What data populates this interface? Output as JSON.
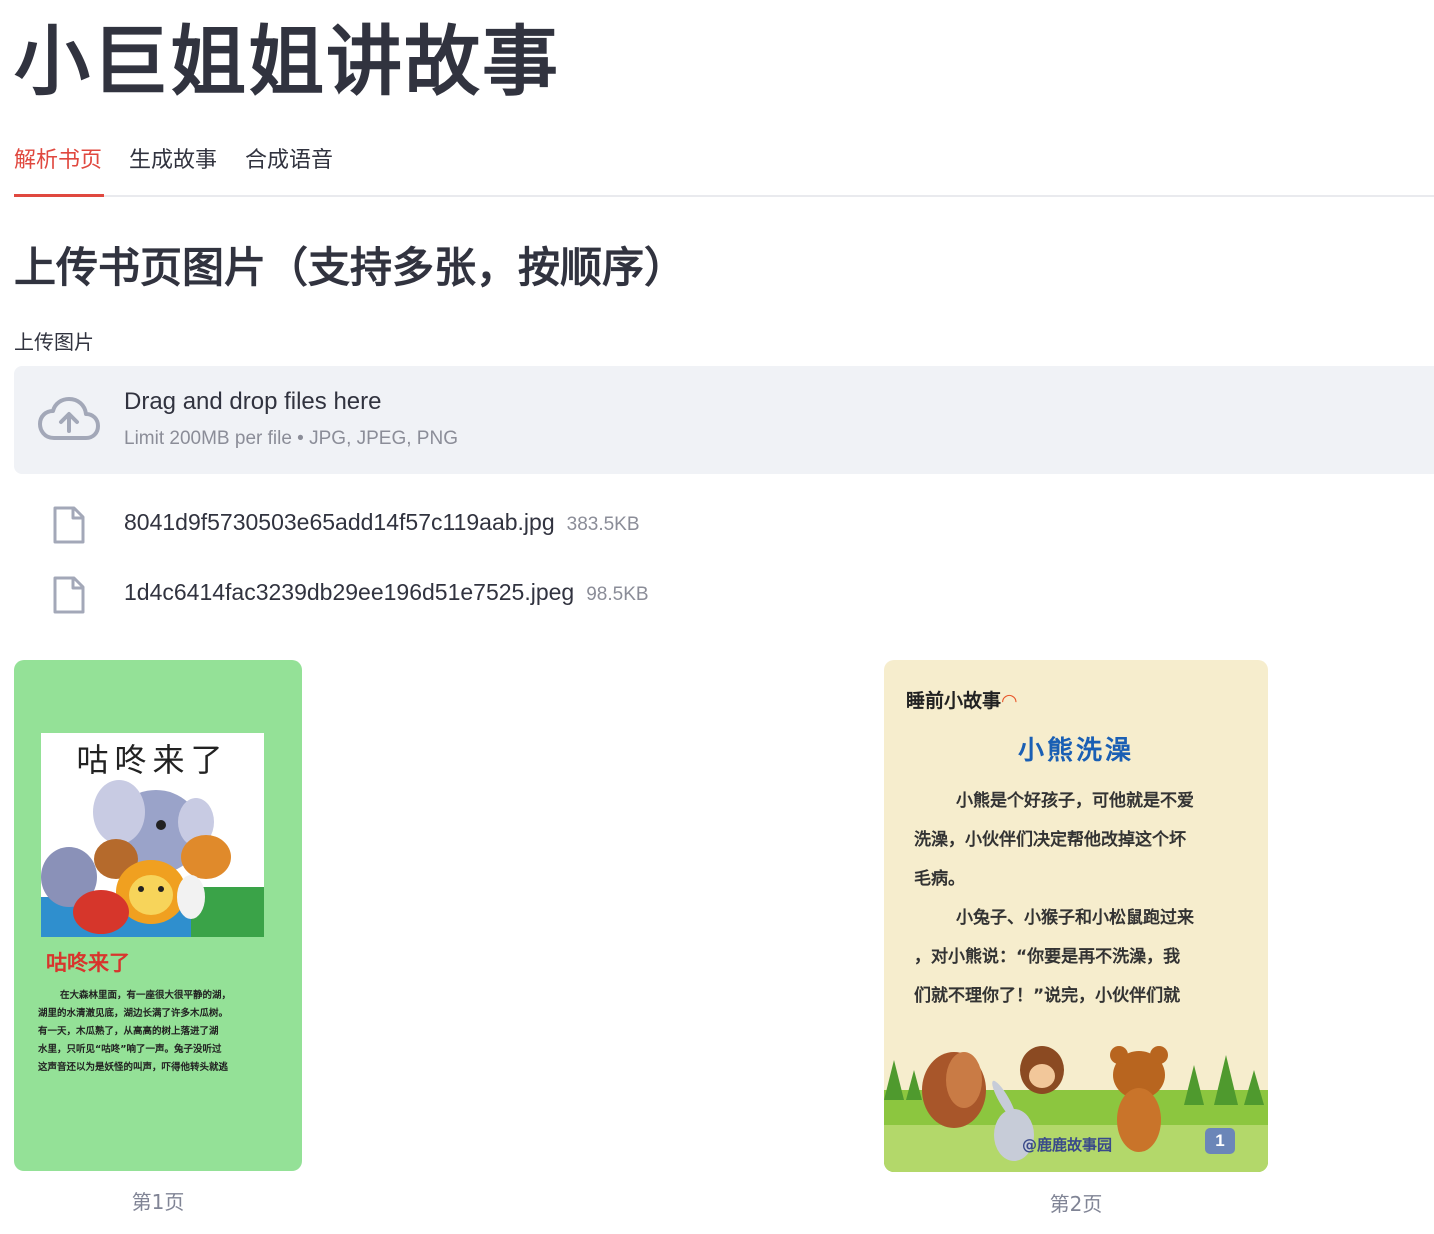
{
  "app": {
    "title": "小巨姐姐讲故事"
  },
  "tabs": [
    {
      "label": "解析书页",
      "active": true
    },
    {
      "label": "生成故事",
      "active": false
    },
    {
      "label": "合成语音",
      "active": false
    }
  ],
  "section": {
    "title": "上传书页图片（支持多张，按顺序）"
  },
  "uploader": {
    "label": "上传图片",
    "dropzone_main": "Drag and drop files here",
    "dropzone_sub": "Limit 200MB per file • JPG, JPEG, PNG",
    "files": [
      {
        "name": "8041d9f5730503e65add14f57c119aab.jpg",
        "size": "383.5KB"
      },
      {
        "name": "1d4c6414fac3239db29ee196d51e7525.jpeg",
        "size": "98.5KB"
      }
    ]
  },
  "pages": [
    {
      "caption": "第1页",
      "book_title": "咕咚来了",
      "heading": "咕咚来了",
      "body_lines": [
        "在大森林里面，有一座很大很平静的湖，",
        "湖里的水清澈见底，湖边长满了许多木瓜树。",
        "有一天，木瓜熟了，从高高的树上落进了湖",
        "水里，只听见“咕咚”响了一声。兔子没听过",
        "这声音还以为是妖怪的叫声，吓得他转头就逃"
      ],
      "bg_color": "#94e197"
    },
    {
      "caption": "第2页",
      "series": "睡前小故事",
      "heading": "小熊洗澡",
      "body_lines": [
        "小熊是个好孩子，可他就是不爱",
        "洗澡，小伙伴们决定帮他改掉这个坏",
        "毛病。",
        "小兔子、小猴子和小松鼠跑过来",
        "，对小熊说：“你要是再不洗澡，我",
        "们就不理你了！”说完，小伙伴们就"
      ],
      "watermark": "@鹿鹿故事园",
      "page_number": "1",
      "bg_color": "#f6edcd"
    }
  ],
  "colors": {
    "accent": "#e0483f",
    "text": "#31333f",
    "muted": "#808495",
    "dropzone_bg": "#f0f2f6"
  }
}
